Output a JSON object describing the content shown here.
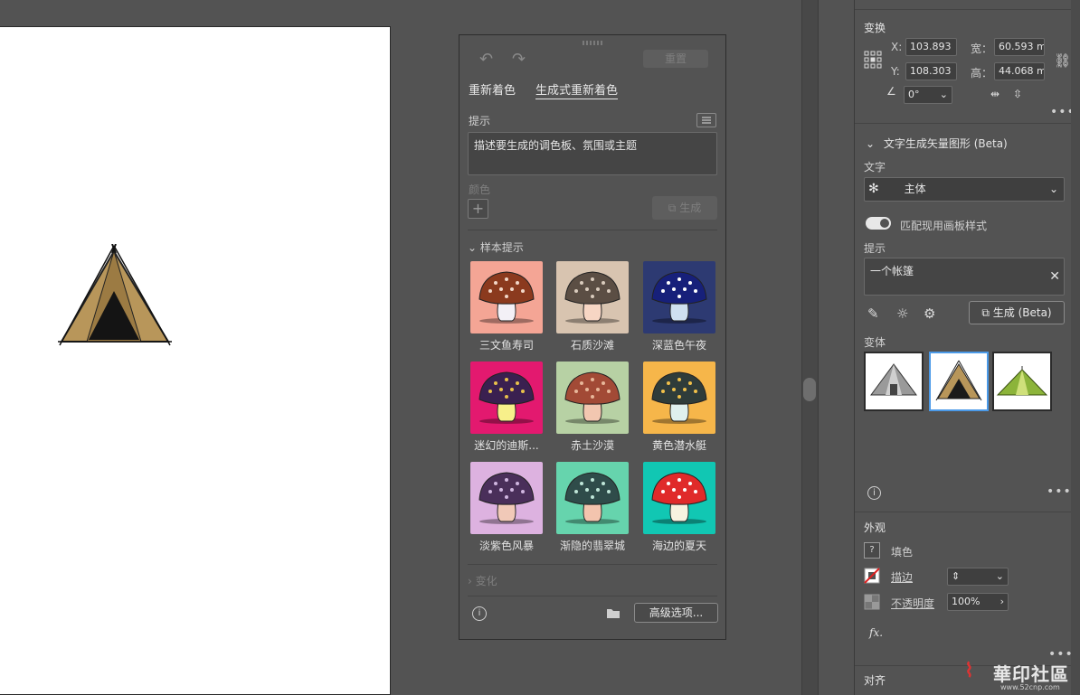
{
  "recolor_panel": {
    "reset_label": "重置",
    "tabs": [
      {
        "label": "重新着色",
        "active": false
      },
      {
        "label": "生成式重新着色",
        "active": true
      }
    ],
    "prompt_label": "提示",
    "prompt_placeholder": "描述要生成的调色板、氛围或主题",
    "color_label": "颜色",
    "generate_label": "生成",
    "sample_prompts_label": "样本提示",
    "samples": [
      {
        "label": "三文鱼寿司",
        "bg": "#f4a595",
        "cap": "#8b3a1e",
        "stem": "#f3f0f6",
        "spots": "#f2d7c8"
      },
      {
        "label": "石质沙滩",
        "bg": "#d8c4b0",
        "cap": "#5b4e44",
        "stem": "#f7d6c4",
        "spots": "#d9cbbd"
      },
      {
        "label": "深蓝色午夜",
        "bg": "#2d3a72",
        "cap": "#17207a",
        "stem": "#cfe0f0",
        "spots": "#ffffff"
      },
      {
        "label": "迷幻的迪斯...",
        "bg": "#e3196f",
        "cap": "#3a2050",
        "stem": "#f7f08a",
        "spots": "#e8c04a"
      },
      {
        "label": "赤土沙漠",
        "bg": "#b7d1a4",
        "cap": "#a24a36",
        "stem": "#f2c7b0",
        "spots": "#e8b79a"
      },
      {
        "label": "黄色潜水艇",
        "bg": "#f6b64a",
        "cap": "#2f3c3a",
        "stem": "#dff0ee",
        "spots": "#f0c04a"
      },
      {
        "label": "淡紫色风暴",
        "bg": "#ddb2e0",
        "cap": "#4a2f5a",
        "stem": "#f1c9b8",
        "spots": "#d0b6e0"
      },
      {
        "label": "渐隐的翡翠城",
        "bg": "#66d4ad",
        "cap": "#2f4c4a",
        "stem": "#f3c4ae",
        "spots": "#bfe6d8"
      },
      {
        "label": "海边的夏天",
        "bg": "#11c7b3",
        "cap": "#e02a2a",
        "stem": "#f7f3e0",
        "spots": "#ffffff"
      }
    ],
    "variations_label": "变化",
    "advanced_label": "高级选项..."
  },
  "properties_panel": {
    "transform_title": "变换",
    "x_label": "X:",
    "x_value": "103.893",
    "y_label": "Y:",
    "y_value": "108.303",
    "w_label": "宽：",
    "w_value": "60.593 m",
    "h_label": "高：",
    "h_value": "44.068 m",
    "angle_value": "0°",
    "tvg_title": "文字生成矢量图形 (Beta)",
    "type_label": "文字",
    "type_value": "主体",
    "match_style_label": "匹配现用画板样式",
    "prompt_label": "提示",
    "prompt_value": "一个帐篷",
    "generate_label": "生成 (Beta)",
    "variants_label": "变体",
    "appearance_title": "外观",
    "fill_label": "填色",
    "stroke_label": "描边",
    "opacity_label": "不透明度",
    "opacity_value": "100%",
    "fx_label": "fx.",
    "align_title": "对齐"
  },
  "watermark": {
    "text": "華印社區",
    "url": "www.52cnp.com"
  }
}
